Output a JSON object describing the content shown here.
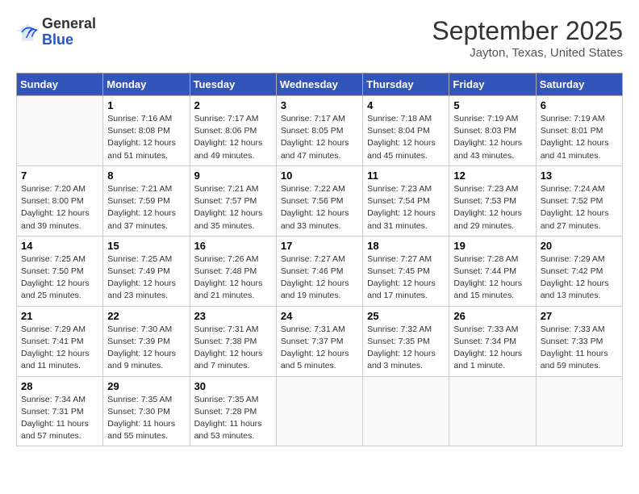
{
  "header": {
    "logo_line1": "General",
    "logo_line2": "Blue",
    "month": "September 2025",
    "location": "Jayton, Texas, United States"
  },
  "days_of_week": [
    "Sunday",
    "Monday",
    "Tuesday",
    "Wednesday",
    "Thursday",
    "Friday",
    "Saturday"
  ],
  "weeks": [
    [
      {
        "num": "",
        "info": ""
      },
      {
        "num": "1",
        "info": "Sunrise: 7:16 AM\nSunset: 8:08 PM\nDaylight: 12 hours\nand 51 minutes."
      },
      {
        "num": "2",
        "info": "Sunrise: 7:17 AM\nSunset: 8:06 PM\nDaylight: 12 hours\nand 49 minutes."
      },
      {
        "num": "3",
        "info": "Sunrise: 7:17 AM\nSunset: 8:05 PM\nDaylight: 12 hours\nand 47 minutes."
      },
      {
        "num": "4",
        "info": "Sunrise: 7:18 AM\nSunset: 8:04 PM\nDaylight: 12 hours\nand 45 minutes."
      },
      {
        "num": "5",
        "info": "Sunrise: 7:19 AM\nSunset: 8:03 PM\nDaylight: 12 hours\nand 43 minutes."
      },
      {
        "num": "6",
        "info": "Sunrise: 7:19 AM\nSunset: 8:01 PM\nDaylight: 12 hours\nand 41 minutes."
      }
    ],
    [
      {
        "num": "7",
        "info": "Sunrise: 7:20 AM\nSunset: 8:00 PM\nDaylight: 12 hours\nand 39 minutes."
      },
      {
        "num": "8",
        "info": "Sunrise: 7:21 AM\nSunset: 7:59 PM\nDaylight: 12 hours\nand 37 minutes."
      },
      {
        "num": "9",
        "info": "Sunrise: 7:21 AM\nSunset: 7:57 PM\nDaylight: 12 hours\nand 35 minutes."
      },
      {
        "num": "10",
        "info": "Sunrise: 7:22 AM\nSunset: 7:56 PM\nDaylight: 12 hours\nand 33 minutes."
      },
      {
        "num": "11",
        "info": "Sunrise: 7:23 AM\nSunset: 7:54 PM\nDaylight: 12 hours\nand 31 minutes."
      },
      {
        "num": "12",
        "info": "Sunrise: 7:23 AM\nSunset: 7:53 PM\nDaylight: 12 hours\nand 29 minutes."
      },
      {
        "num": "13",
        "info": "Sunrise: 7:24 AM\nSunset: 7:52 PM\nDaylight: 12 hours\nand 27 minutes."
      }
    ],
    [
      {
        "num": "14",
        "info": "Sunrise: 7:25 AM\nSunset: 7:50 PM\nDaylight: 12 hours\nand 25 minutes."
      },
      {
        "num": "15",
        "info": "Sunrise: 7:25 AM\nSunset: 7:49 PM\nDaylight: 12 hours\nand 23 minutes."
      },
      {
        "num": "16",
        "info": "Sunrise: 7:26 AM\nSunset: 7:48 PM\nDaylight: 12 hours\nand 21 minutes."
      },
      {
        "num": "17",
        "info": "Sunrise: 7:27 AM\nSunset: 7:46 PM\nDaylight: 12 hours\nand 19 minutes."
      },
      {
        "num": "18",
        "info": "Sunrise: 7:27 AM\nSunset: 7:45 PM\nDaylight: 12 hours\nand 17 minutes."
      },
      {
        "num": "19",
        "info": "Sunrise: 7:28 AM\nSunset: 7:44 PM\nDaylight: 12 hours\nand 15 minutes."
      },
      {
        "num": "20",
        "info": "Sunrise: 7:29 AM\nSunset: 7:42 PM\nDaylight: 12 hours\nand 13 minutes."
      }
    ],
    [
      {
        "num": "21",
        "info": "Sunrise: 7:29 AM\nSunset: 7:41 PM\nDaylight: 12 hours\nand 11 minutes."
      },
      {
        "num": "22",
        "info": "Sunrise: 7:30 AM\nSunset: 7:39 PM\nDaylight: 12 hours\nand 9 minutes."
      },
      {
        "num": "23",
        "info": "Sunrise: 7:31 AM\nSunset: 7:38 PM\nDaylight: 12 hours\nand 7 minutes."
      },
      {
        "num": "24",
        "info": "Sunrise: 7:31 AM\nSunset: 7:37 PM\nDaylight: 12 hours\nand 5 minutes."
      },
      {
        "num": "25",
        "info": "Sunrise: 7:32 AM\nSunset: 7:35 PM\nDaylight: 12 hours\nand 3 minutes."
      },
      {
        "num": "26",
        "info": "Sunrise: 7:33 AM\nSunset: 7:34 PM\nDaylight: 12 hours\nand 1 minute."
      },
      {
        "num": "27",
        "info": "Sunrise: 7:33 AM\nSunset: 7:33 PM\nDaylight: 11 hours\nand 59 minutes."
      }
    ],
    [
      {
        "num": "28",
        "info": "Sunrise: 7:34 AM\nSunset: 7:31 PM\nDaylight: 11 hours\nand 57 minutes."
      },
      {
        "num": "29",
        "info": "Sunrise: 7:35 AM\nSunset: 7:30 PM\nDaylight: 11 hours\nand 55 minutes."
      },
      {
        "num": "30",
        "info": "Sunrise: 7:35 AM\nSunset: 7:28 PM\nDaylight: 11 hours\nand 53 minutes."
      },
      {
        "num": "",
        "info": ""
      },
      {
        "num": "",
        "info": ""
      },
      {
        "num": "",
        "info": ""
      },
      {
        "num": "",
        "info": ""
      }
    ]
  ]
}
